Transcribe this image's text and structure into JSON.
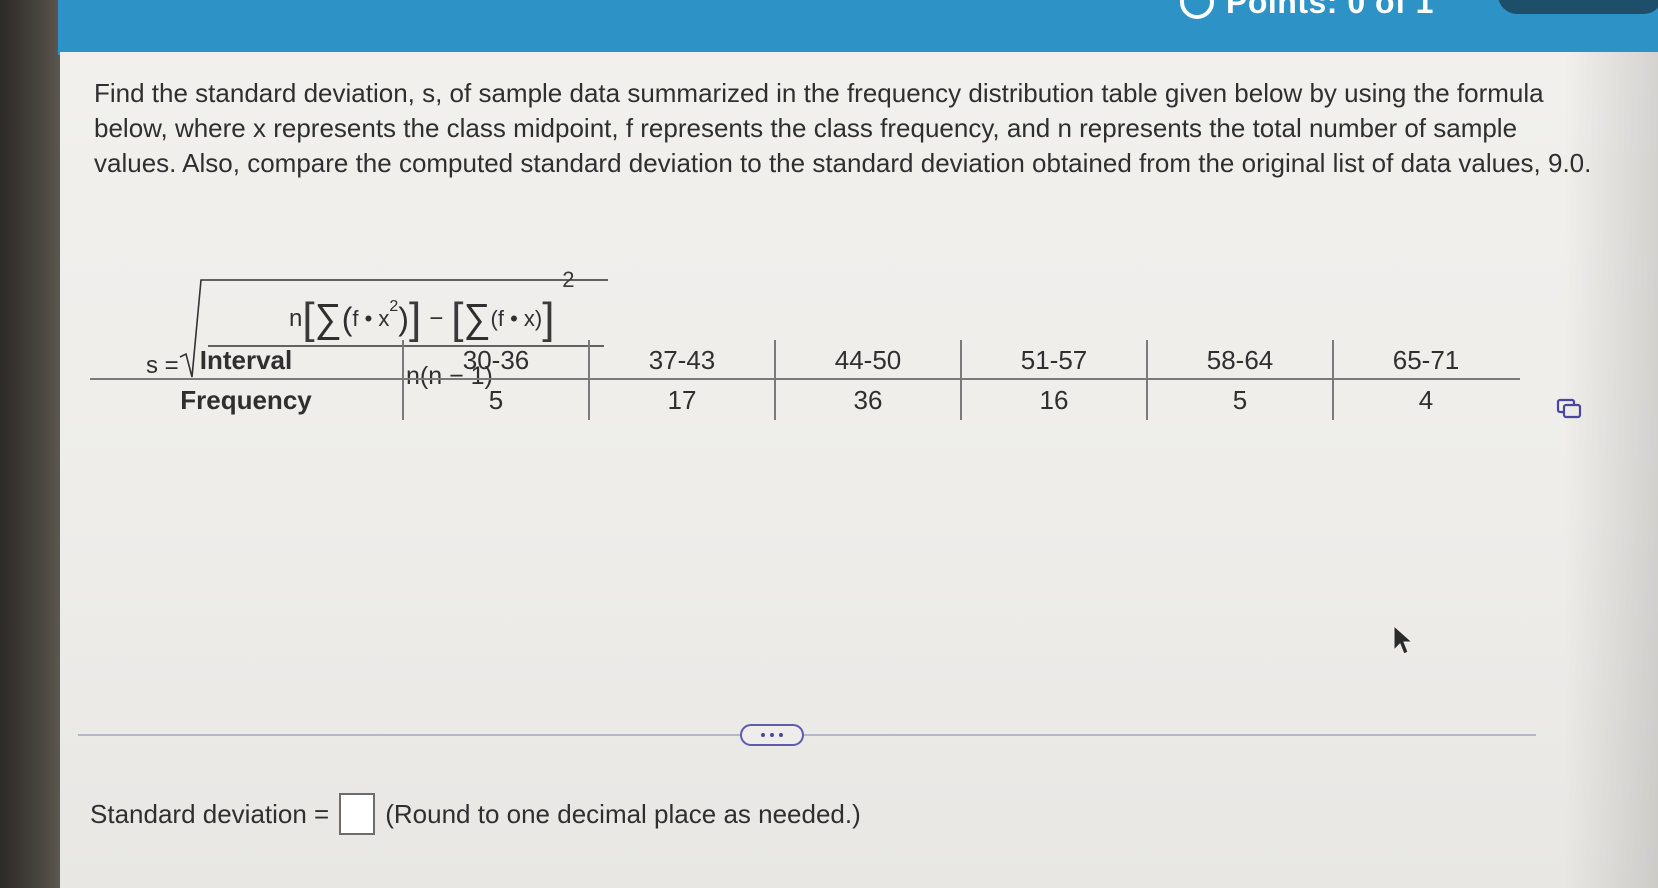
{
  "header": {
    "points_label": "Points: 0 of 1"
  },
  "question": {
    "text": "Find the standard deviation, s, of sample data summarized in the frequency distribution table given below by using the formula below, where x represents the class midpoint, f represents the class frequency, and n represents the total number of sample values. Also, compare the computed standard deviation to the standard deviation obtained from the original list of data values, 9.0."
  },
  "formula": {
    "lhs": "s =",
    "n": "n",
    "sum": "∑",
    "f_dot_x2": "f • x",
    "exp": "2",
    "minus": "−",
    "f_dot_x": "(f • x)",
    "outer_exp": "2",
    "denominator": "n(n − 1)"
  },
  "table": {
    "row_headers": [
      "Interval",
      "Frequency"
    ],
    "intervals": [
      "30-36",
      "37-43",
      "44-50",
      "51-57",
      "58-64",
      "65-71"
    ],
    "frequencies": [
      "5",
      "17",
      "36",
      "16",
      "5",
      "4"
    ]
  },
  "answer": {
    "label": "Standard deviation =",
    "input_value": "",
    "hint": "(Round to one decimal place as needed.)"
  },
  "icons": {
    "copy": "copy-icon",
    "expand": "more-dots-icon",
    "cursor": "mouse-pointer-icon",
    "points": "circle-icon"
  },
  "colors": {
    "topbar": "#2d93c7",
    "text": "#2f2f2f",
    "divider": "#b9b4cf",
    "accent": "#5f5ab0"
  }
}
